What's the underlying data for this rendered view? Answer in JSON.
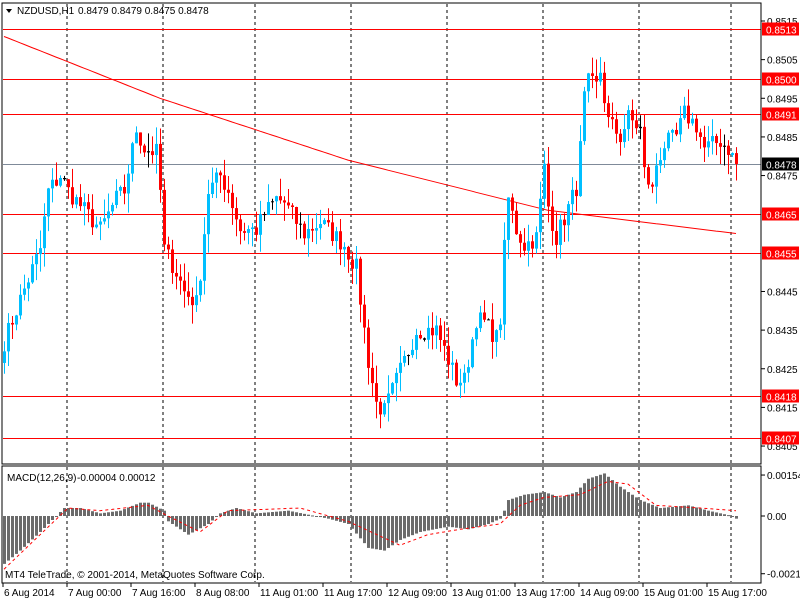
{
  "header": {
    "symbol_label": "NZDUSD,H1",
    "ohlc_text": "0.8479 0.8479 0.8475 0.8478"
  },
  "indicator": {
    "label": "MACD(12,26,9)",
    "values_text": "-0.00004 0.00012",
    "axis_ticks": [
      "0.00154",
      "0.00",
      "-0.00217"
    ],
    "axis_values": [
      0.00154,
      0,
      -0.00217
    ]
  },
  "copyright": "MT4 TeleTrade, © 2001-2014, MetaQuotes Software Corp.",
  "colors": {
    "bull": "#00bfff",
    "bear": "#ff0000",
    "doji": "#000000",
    "level_line": "#ff0000",
    "current_line": "#7f8a99",
    "histogram": "#6b6b6b",
    "signal": "#ff0000"
  },
  "price_axis": {
    "range": [
      0.8405,
      0.8515
    ],
    "ticks": [
      "0.8515",
      "0.8505",
      "0.8495",
      "0.8485",
      "0.8475",
      "0.8445",
      "0.8435",
      "0.8425",
      "0.8415",
      "0.8405"
    ]
  },
  "levels": [
    "0.8513",
    "0.8500",
    "0.8491",
    "0.8465",
    "0.8455",
    "0.8418",
    "0.8407"
  ],
  "current_price": "0.8478",
  "time_axis": [
    "6 Aug 2014",
    "7 Aug 00:00",
    "7 Aug 16:00",
    "8 Aug 08:00",
    "11 Aug 01:00",
    "11 Aug 17:00",
    "12 Aug 09:00",
    "13 Aug 01:00",
    "13 Aug 17:00",
    "14 Aug 09:00",
    "15 Aug 01:00",
    "15 Aug 17:00"
  ],
  "chart_data": {
    "type": "candlestick",
    "timeframe": "H1",
    "bar_count": 184,
    "close_keypoints": [
      [
        0,
        0.8432
      ],
      [
        4,
        0.8443
      ],
      [
        9,
        0.8456
      ],
      [
        11,
        0.8471
      ],
      [
        14,
        0.8475
      ],
      [
        16,
        0.8471
      ],
      [
        20,
        0.8466
      ],
      [
        24,
        0.8461
      ],
      [
        28,
        0.8469
      ],
      [
        30,
        0.8471
      ],
      [
        33,
        0.8487
      ],
      [
        35,
        0.8482
      ],
      [
        38,
        0.8481
      ],
      [
        39,
        0.8471
      ],
      [
        40,
        0.8456
      ],
      [
        43,
        0.845
      ],
      [
        45,
        0.8445
      ],
      [
        48,
        0.8442
      ],
      [
        49,
        0.845
      ],
      [
        51,
        0.8471
      ],
      [
        54,
        0.8475
      ],
      [
        56,
        0.8471
      ],
      [
        59,
        0.8461
      ],
      [
        63,
        0.8461
      ],
      [
        65,
        0.8465
      ],
      [
        68,
        0.8469
      ],
      [
        70,
        0.8468
      ],
      [
        73,
        0.8463
      ],
      [
        75,
        0.846
      ],
      [
        79,
        0.8463
      ],
      [
        83,
        0.8459
      ],
      [
        85,
        0.8457
      ],
      [
        88,
        0.8451
      ],
      [
        89,
        0.8443
      ],
      [
        91,
        0.8427
      ],
      [
        93,
        0.8416
      ],
      [
        95,
        0.8414
      ],
      [
        98,
        0.8422
      ],
      [
        100,
        0.8427
      ],
      [
        103,
        0.8435
      ],
      [
        105,
        0.8435
      ],
      [
        108,
        0.8435
      ],
      [
        110,
        0.843
      ],
      [
        113,
        0.8422
      ],
      [
        115,
        0.8422
      ],
      [
        118,
        0.8438
      ],
      [
        120,
        0.8437
      ],
      [
        123,
        0.8433
      ],
      [
        124,
        0.8438
      ],
      [
        125,
        0.8456
      ],
      [
        126,
        0.8469
      ],
      [
        128,
        0.8461
      ],
      [
        130,
        0.8457
      ],
      [
        133,
        0.8459
      ],
      [
        135,
        0.8477
      ],
      [
        136,
        0.8467
      ],
      [
        138,
        0.8459
      ],
      [
        140,
        0.8464
      ],
      [
        143,
        0.8472
      ],
      [
        144,
        0.8482
      ],
      [
        145,
        0.8495
      ],
      [
        146,
        0.8499
      ],
      [
        148,
        0.8498
      ],
      [
        149,
        0.8502
      ],
      [
        150,
        0.8495
      ],
      [
        151,
        0.8489
      ],
      [
        154,
        0.8485
      ],
      [
        156,
        0.849
      ],
      [
        159,
        0.8487
      ],
      [
        160,
        0.8476
      ],
      [
        162,
        0.8471
      ],
      [
        163,
        0.8478
      ],
      [
        165,
        0.8483
      ],
      [
        168,
        0.8485
      ],
      [
        170,
        0.8491
      ],
      [
        173,
        0.8488
      ],
      [
        175,
        0.8482
      ],
      [
        179,
        0.8484
      ],
      [
        181,
        0.8482
      ],
      [
        183,
        0.8478
      ]
    ],
    "ma_keypoints": [
      [
        0,
        0.8511
      ],
      [
        39,
        0.8495
      ],
      [
        86,
        0.8479
      ],
      [
        136,
        0.8466
      ],
      [
        183,
        0.846
      ]
    ],
    "macd_histogram_keypoints": [
      [
        0,
        -0.0018
      ],
      [
        4,
        -0.0013
      ],
      [
        9,
        -0.0006
      ],
      [
        13,
        0.0
      ],
      [
        15,
        0.0003
      ],
      [
        19,
        0.0003
      ],
      [
        24,
        0.0001
      ],
      [
        29,
        0.0002
      ],
      [
        34,
        0.0005
      ],
      [
        36,
        0.0005
      ],
      [
        40,
        0.0002
      ],
      [
        41,
        -0.0002
      ],
      [
        46,
        -0.0007
      ],
      [
        51,
        -0.0003
      ],
      [
        54,
        0.0001
      ],
      [
        58,
        0.0003
      ],
      [
        63,
        0.0001
      ],
      [
        71,
        0.0002
      ],
      [
        81,
        -0.0001
      ],
      [
        86,
        -0.0003
      ],
      [
        91,
        -0.0012
      ],
      [
        95,
        -0.0013
      ],
      [
        99,
        -0.0009
      ],
      [
        104,
        -0.0006
      ],
      [
        111,
        -0.0004
      ],
      [
        116,
        -0.0005
      ],
      [
        121,
        -0.0003
      ],
      [
        124,
        -0.0001
      ],
      [
        125,
        0.0002
      ],
      [
        126,
        0.0006
      ],
      [
        130,
        0.0008
      ],
      [
        135,
        0.0009
      ],
      [
        139,
        0.0007
      ],
      [
        143,
        0.0009
      ],
      [
        146,
        0.0014
      ],
      [
        150,
        0.0016
      ],
      [
        154,
        0.0011
      ],
      [
        159,
        0.0006
      ],
      [
        164,
        0.0003
      ],
      [
        171,
        0.0004
      ],
      [
        176,
        0.0002
      ],
      [
        182,
        0.0
      ],
      [
        183,
        -0.0001
      ]
    ],
    "macd_signal_keypoints": [
      [
        0,
        -0.002
      ],
      [
        16,
        0.0003
      ],
      [
        24,
        0.0002
      ],
      [
        36,
        0.0004
      ],
      [
        41,
        0.0
      ],
      [
        49,
        -0.0006
      ],
      [
        56,
        0.0002
      ],
      [
        74,
        0.0003
      ],
      [
        86,
        -0.0002
      ],
      [
        99,
        -0.0011
      ],
      [
        106,
        -0.0007
      ],
      [
        114,
        -0.0005
      ],
      [
        124,
        -0.0003
      ],
      [
        129,
        0.0004
      ],
      [
        135,
        0.0007
      ],
      [
        144,
        0.0008
      ],
      [
        151,
        0.0013
      ],
      [
        156,
        0.0012
      ],
      [
        163,
        0.0004
      ],
      [
        174,
        0.0003
      ],
      [
        183,
        0.0002
      ]
    ]
  }
}
